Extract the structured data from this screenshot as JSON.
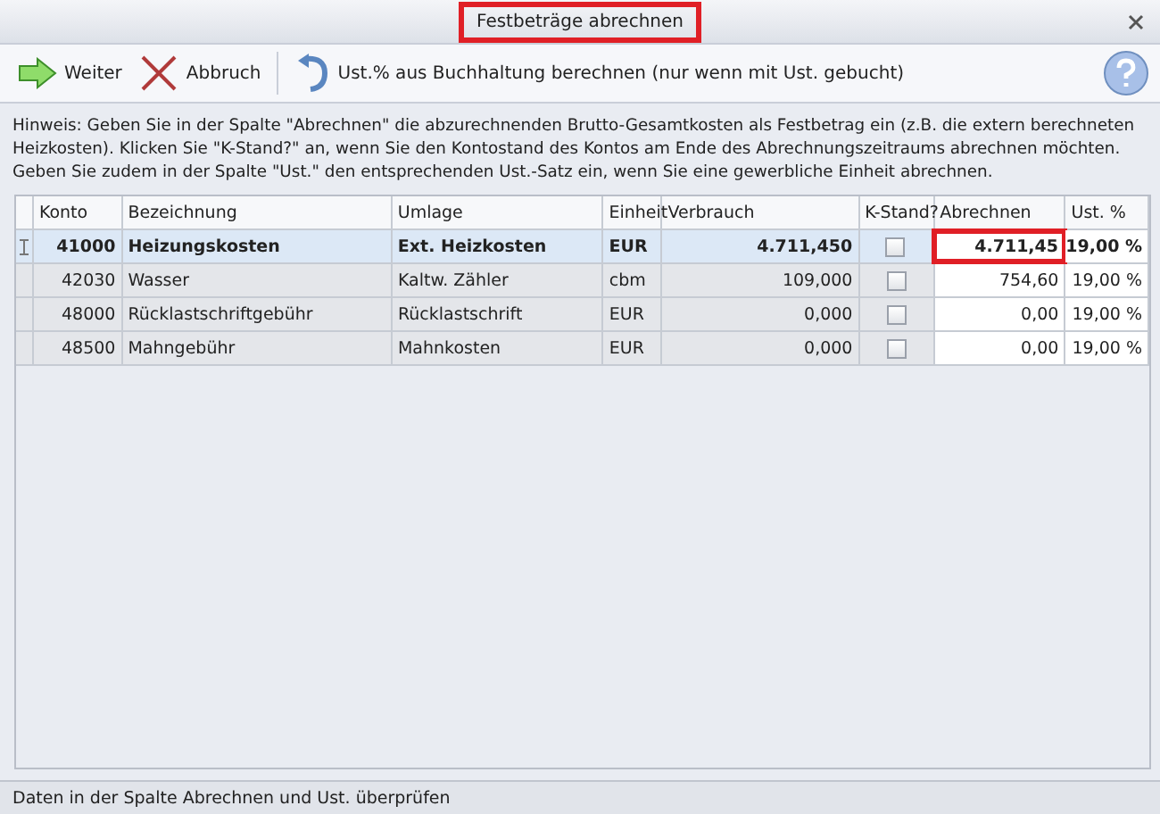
{
  "window": {
    "title": "Festbeträge abrechnen",
    "title_highlighted": true
  },
  "toolbar": [
    {
      "kind": "next",
      "label": "Weiter"
    },
    {
      "kind": "cancel",
      "label": "Abbruch"
    },
    {
      "kind": "undo",
      "label": "Ust.% aus Buchhaltung berechnen (nur wenn mit Ust. gebucht)"
    }
  ],
  "hint": "Hinweis: Geben Sie in der Spalte \"Abrechnen\" die abzurechnenden Brutto-Gesamtkosten als Festbetrag ein (z.B. die extern berechneten Heizkosten). Klicken Sie \"K-Stand?\" an, wenn Sie den Kontostand des Kontos am Ende des Abrechnungszeitraums abrechnen möchten. Geben Sie zudem in der Spalte \"Ust.\" den entsprechenden Ust.-Satz ein, wenn Sie eine gewerbliche Einheit abrechnen.",
  "table": {
    "columns": [
      "Konto",
      "Bezeichnung",
      "Umlage",
      "Einheit",
      "Verbrauch",
      "K-Stand?",
      "Abrechnen",
      "Ust. %"
    ],
    "rows": [
      {
        "selected": true,
        "konto": "41000",
        "bezeichnung": "Heizungskosten",
        "umlage": "Ext. Heizkosten",
        "einheit": "EUR",
        "verbrauch": "4.711,450",
        "k_stand": false,
        "abrechnen": "4.711,45",
        "abrechnen_highlighted": true,
        "ust": "19,00 %"
      },
      {
        "selected": false,
        "konto": "42030",
        "bezeichnung": "Wasser",
        "umlage": "Kaltw. Zähler",
        "einheit": "cbm",
        "verbrauch": "109,000",
        "k_stand": false,
        "abrechnen": "754,60",
        "abrechnen_highlighted": false,
        "ust": "19,00 %"
      },
      {
        "selected": false,
        "konto": "48000",
        "bezeichnung": "Rücklastschriftgebühr",
        "umlage": "Rücklastschrift",
        "einheit": "EUR",
        "verbrauch": "0,000",
        "k_stand": false,
        "abrechnen": "0,00",
        "abrechnen_highlighted": false,
        "ust": "19,00 %"
      },
      {
        "selected": false,
        "konto": "48500",
        "bezeichnung": "Mahngebühr",
        "umlage": "Mahnkosten",
        "einheit": "EUR",
        "verbrauch": "0,000",
        "k_stand": false,
        "abrechnen": "0,00",
        "abrechnen_highlighted": false,
        "ust": "19,00 %"
      }
    ]
  },
  "status_bar": "Daten in der Spalte Abrechnen und Ust. überprüfen"
}
